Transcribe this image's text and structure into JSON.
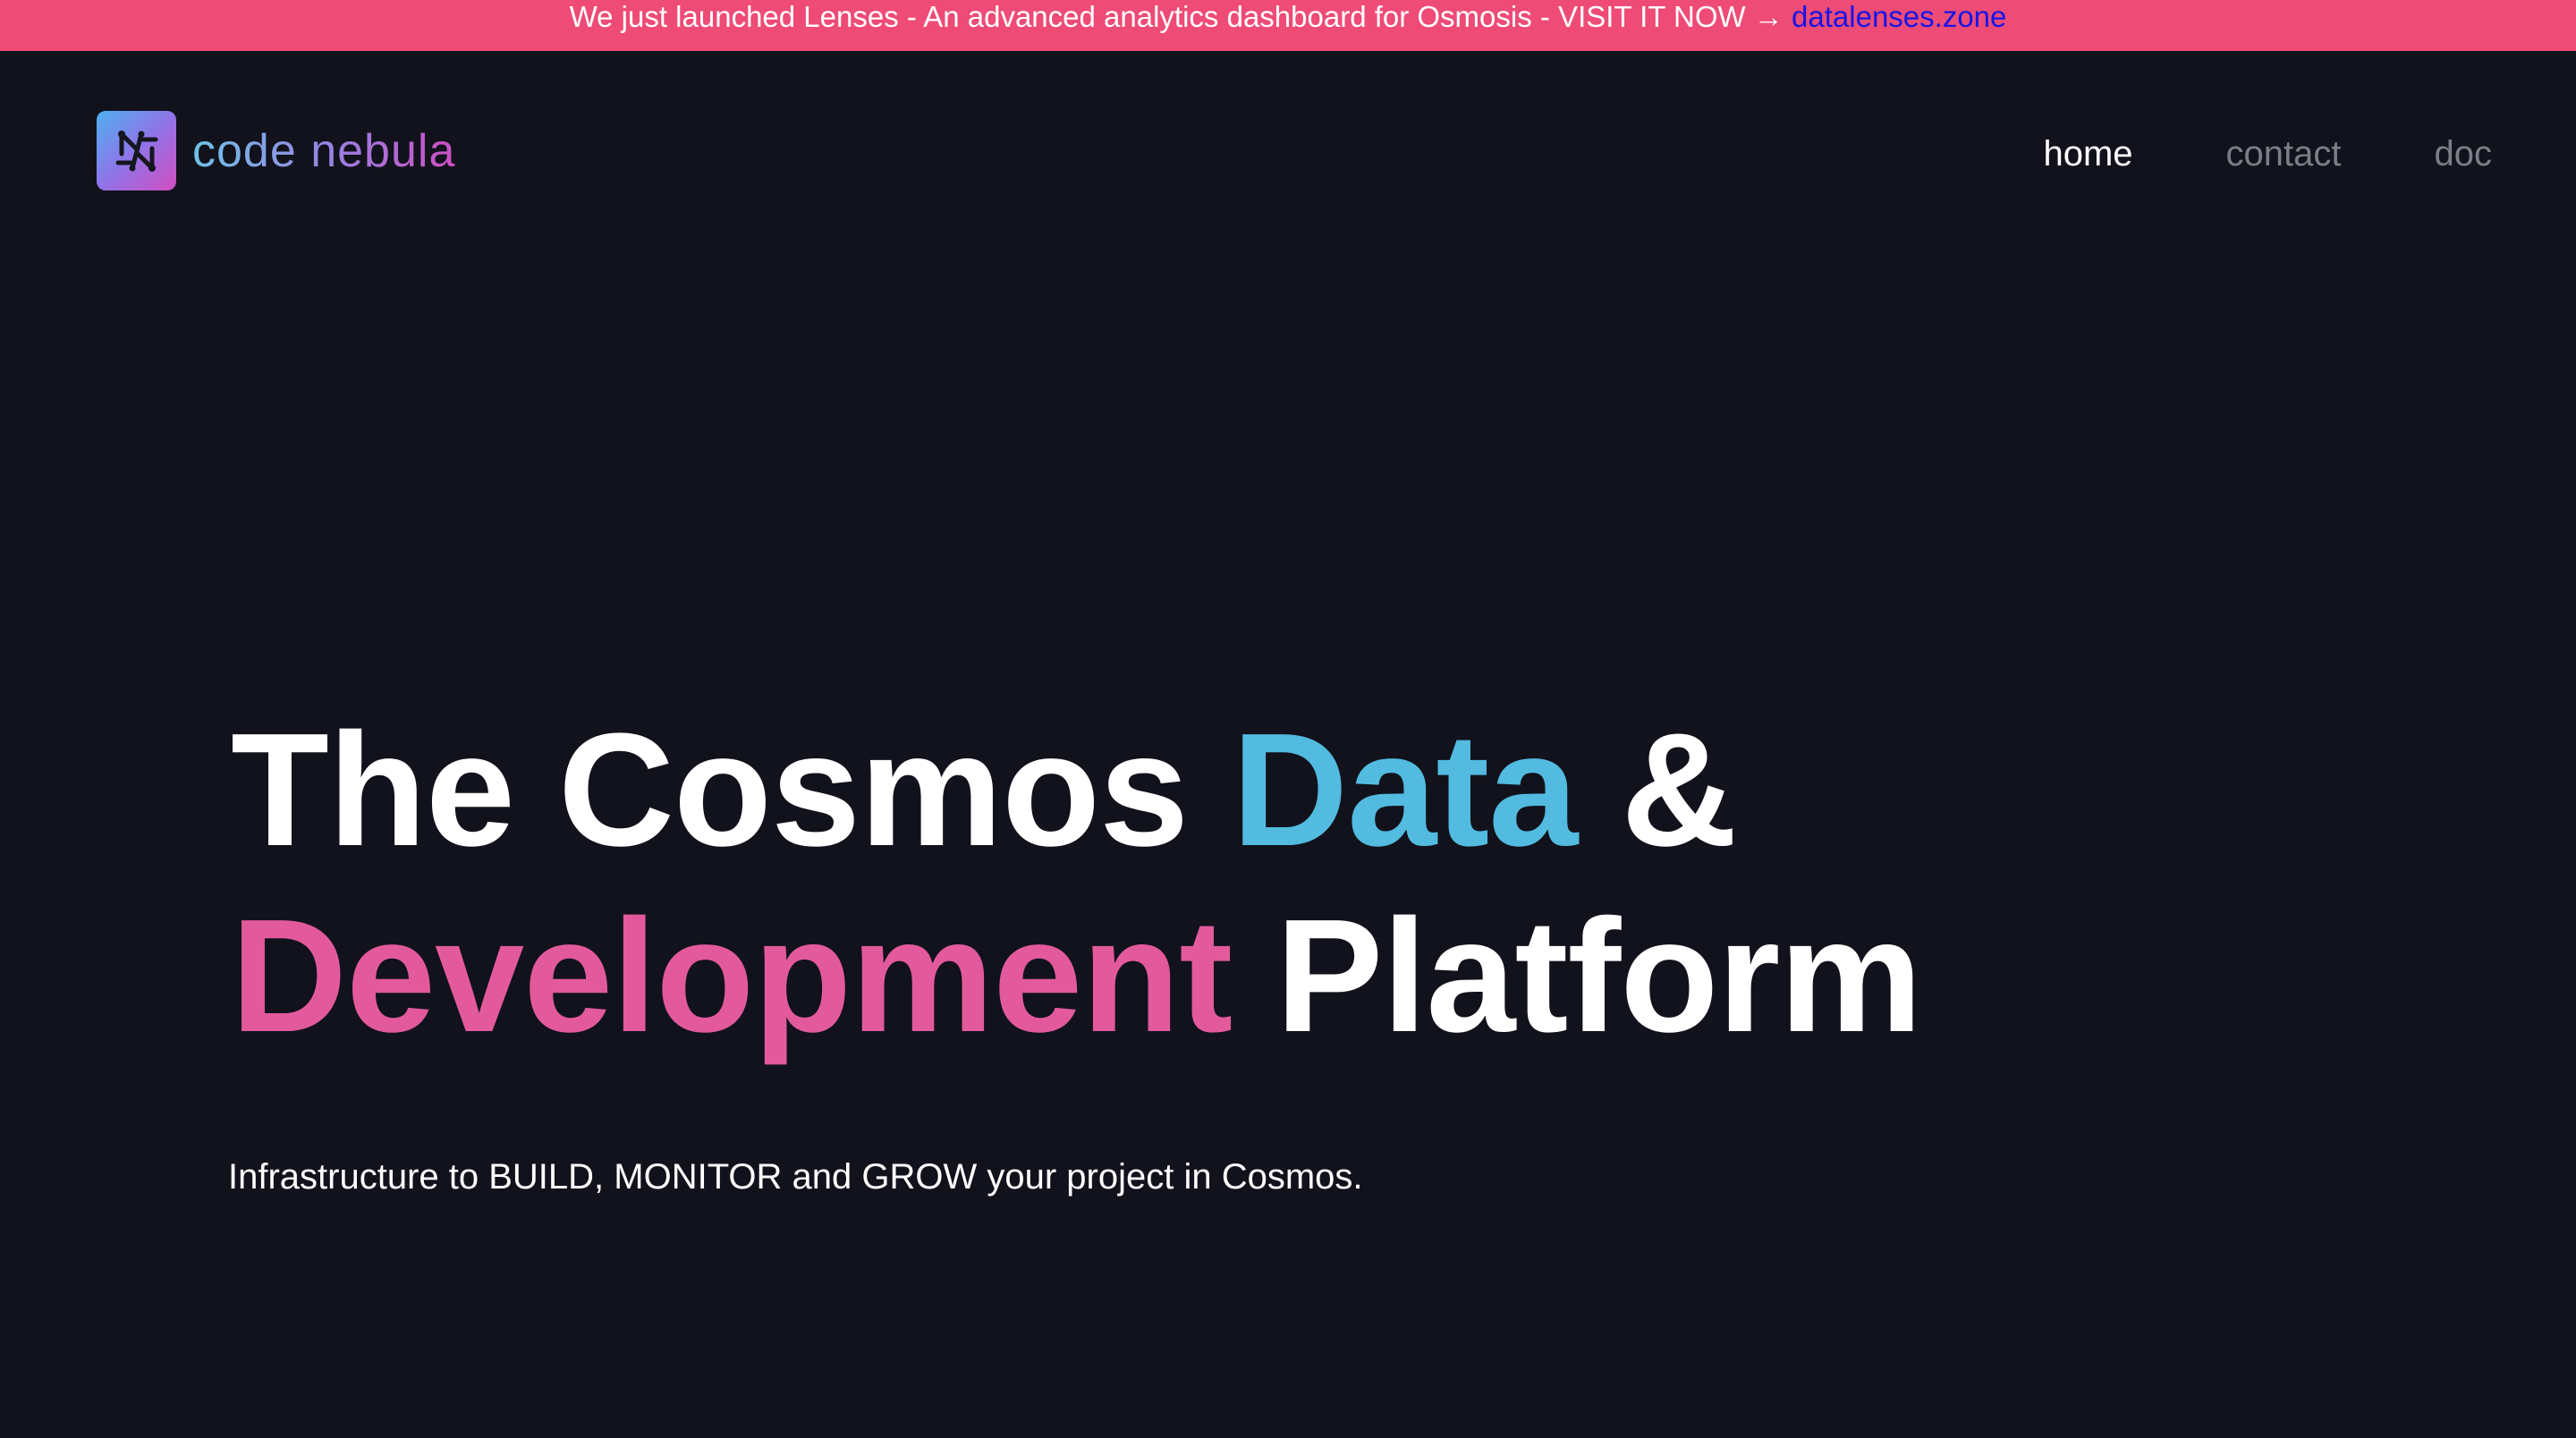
{
  "banner": {
    "message": "We just launched Lenses - An advanced analytics dashboard for Osmosis - VISIT IT NOW → ",
    "link_text": "datalenses.zone",
    "background": "#ee4b76",
    "link_color": "#1515e8"
  },
  "brand": {
    "name": "code nebula",
    "logo_icon": "code-nebula-logo-icon",
    "gradient": [
      "#4fb0f0",
      "#8f74e8",
      "#d24ec0"
    ]
  },
  "nav": {
    "items": [
      {
        "label": "home",
        "active": true
      },
      {
        "label": "contact",
        "active": false
      },
      {
        "label": "doc",
        "active": false
      }
    ]
  },
  "hero": {
    "line1_part1": "The Cosmos ",
    "line1_highlight": "Data",
    "line1_part2": " &",
    "line2_highlight": "Development",
    "line2_part2": " Platform",
    "highlight_colors": {
      "blue": "#52bbdf",
      "pink": "#e35a9c"
    }
  },
  "tagline": "Infrastructure to BUILD, MONITOR and GROW your project in Cosmos.",
  "colors": {
    "background": "#11121c",
    "text": "#ffffff",
    "nav_inactive": "#7c7d86"
  }
}
